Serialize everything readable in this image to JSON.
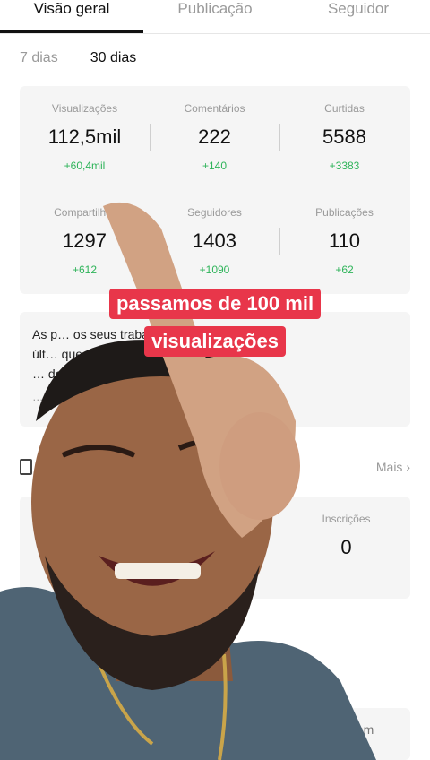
{
  "tabs": [
    {
      "label": "Visão geral"
    },
    {
      "label": "Publicação"
    },
    {
      "label": "Seguidor"
    }
  ],
  "range": {
    "days7": "7 dias",
    "days30": "30 dias",
    "selected": "30 dias"
  },
  "stats": [
    {
      "label": "Visualizações",
      "value": "112,5mil",
      "delta": "+60,4mil"
    },
    {
      "label": "Comentários",
      "value": "222",
      "delta": "+140"
    },
    {
      "label": "Curtidas",
      "value": "5588",
      "delta": "+3383"
    },
    {
      "label": "Compartilhar",
      "value": "1297",
      "delta": "+612"
    },
    {
      "label": "Seguidores",
      "value": "1403",
      "delta": "+1090"
    },
    {
      "label": "Publicações",
      "value": "110",
      "delta": "+62"
    }
  ],
  "insight": {
    "line1": "As p… os seus trabalhos nos",
    "line2": "últ… que 90% de",
    "line3": "… de seguidores.",
    "muted": "… dores para mais"
  },
  "section": {
    "more": "Mais ›"
  },
  "subs": {
    "label": "Inscrições",
    "value": "0"
  },
  "bottom": {
    "text": "oom"
  },
  "caption": {
    "line1": "passamos de 100 mil",
    "line2": "visualizações"
  },
  "colors": {
    "accent": "#e8364a",
    "positive": "#2fb45a"
  }
}
